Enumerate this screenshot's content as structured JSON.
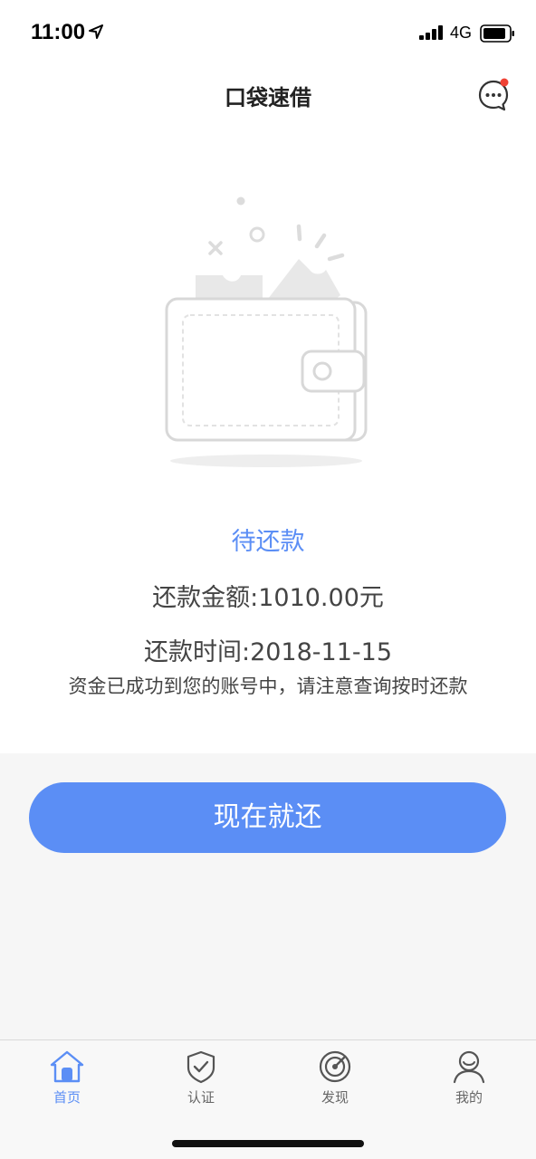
{
  "status_bar": {
    "time": "11:00",
    "network": "4G",
    "icons": [
      "location-arrow-icon",
      "signal-bars-icon",
      "battery-icon"
    ]
  },
  "nav": {
    "title": "口袋速借",
    "message_icon": "chat-bubble-icon",
    "has_notification_dot": true
  },
  "loan": {
    "status": "待还款",
    "amount_text": "还款金额:1010.00元",
    "date_text": "还款时间:2018-11-15",
    "notice": "资金已成功到您的账号中，请注意查询按时还款",
    "illustration": "empty-wallet-illustration"
  },
  "action": {
    "repay_label": "现在就还"
  },
  "tabs": [
    {
      "label": "首页",
      "icon": "home-icon",
      "active": true
    },
    {
      "label": "认证",
      "icon": "shield-check-icon",
      "active": false
    },
    {
      "label": "发现",
      "icon": "radar-icon",
      "active": false
    },
    {
      "label": "我的",
      "icon": "user-icon",
      "active": false
    }
  ],
  "colors": {
    "accent": "#5b8ef5",
    "notification_dot": "#f04134",
    "background": "#f6f6f6"
  }
}
